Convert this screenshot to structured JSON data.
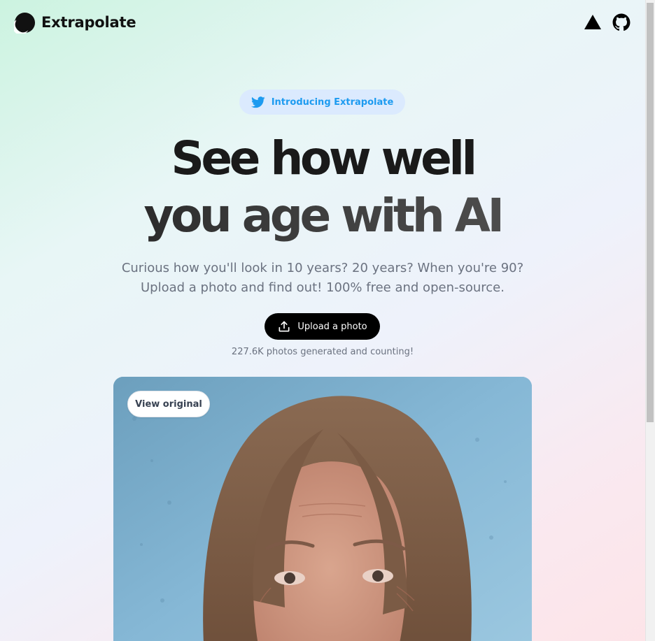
{
  "header": {
    "brand_name": "Extrapolate",
    "icons": [
      "vercel-icon",
      "github-icon"
    ]
  },
  "hero": {
    "announcement": "Introducing Extrapolate",
    "headline_line1": "See how well",
    "headline_line2": "you age with AI",
    "subtitle_line1": "Curious how you'll look in 10 years? 20 years? When you're 90?",
    "subtitle_line2": "Upload a photo and find out! 100% free and open-source.",
    "upload_button": "Upload a photo",
    "counter": "227.6K photos generated and counting!"
  },
  "photo": {
    "view_original_label": "View original"
  },
  "colors": {
    "accent_twitter": "#1d9bf0",
    "pill_bg": "#dbeafe",
    "button_bg": "#000000",
    "muted_text": "#6b7280"
  }
}
